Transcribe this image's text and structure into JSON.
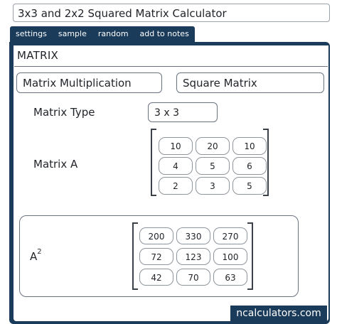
{
  "title": "3x3 and 2x2 Squared Matrix Calculator",
  "tabs": [
    "settings",
    "sample",
    "random",
    "add to notes"
  ],
  "section": "MATRIX",
  "operation": "Matrix Multiplication",
  "mode": "Square Matrix",
  "matrix_type_label": "Matrix Type",
  "matrix_type_value": "3 x 3",
  "matrix_a_label": "Matrix A",
  "matrix_a": [
    [
      "10",
      "20",
      "10"
    ],
    [
      "4",
      "5",
      "6"
    ],
    [
      "2",
      "3",
      "5"
    ]
  ],
  "result_label_base": "A",
  "result_label_exp": "2",
  "result": [
    [
      "200",
      "330",
      "270"
    ],
    [
      "72",
      "123",
      "100"
    ],
    [
      "42",
      "70",
      "63"
    ]
  ],
  "brand": "ncalculators.com",
  "colors": {
    "panel": "#1b3b5a",
    "border": "#6b7280"
  }
}
